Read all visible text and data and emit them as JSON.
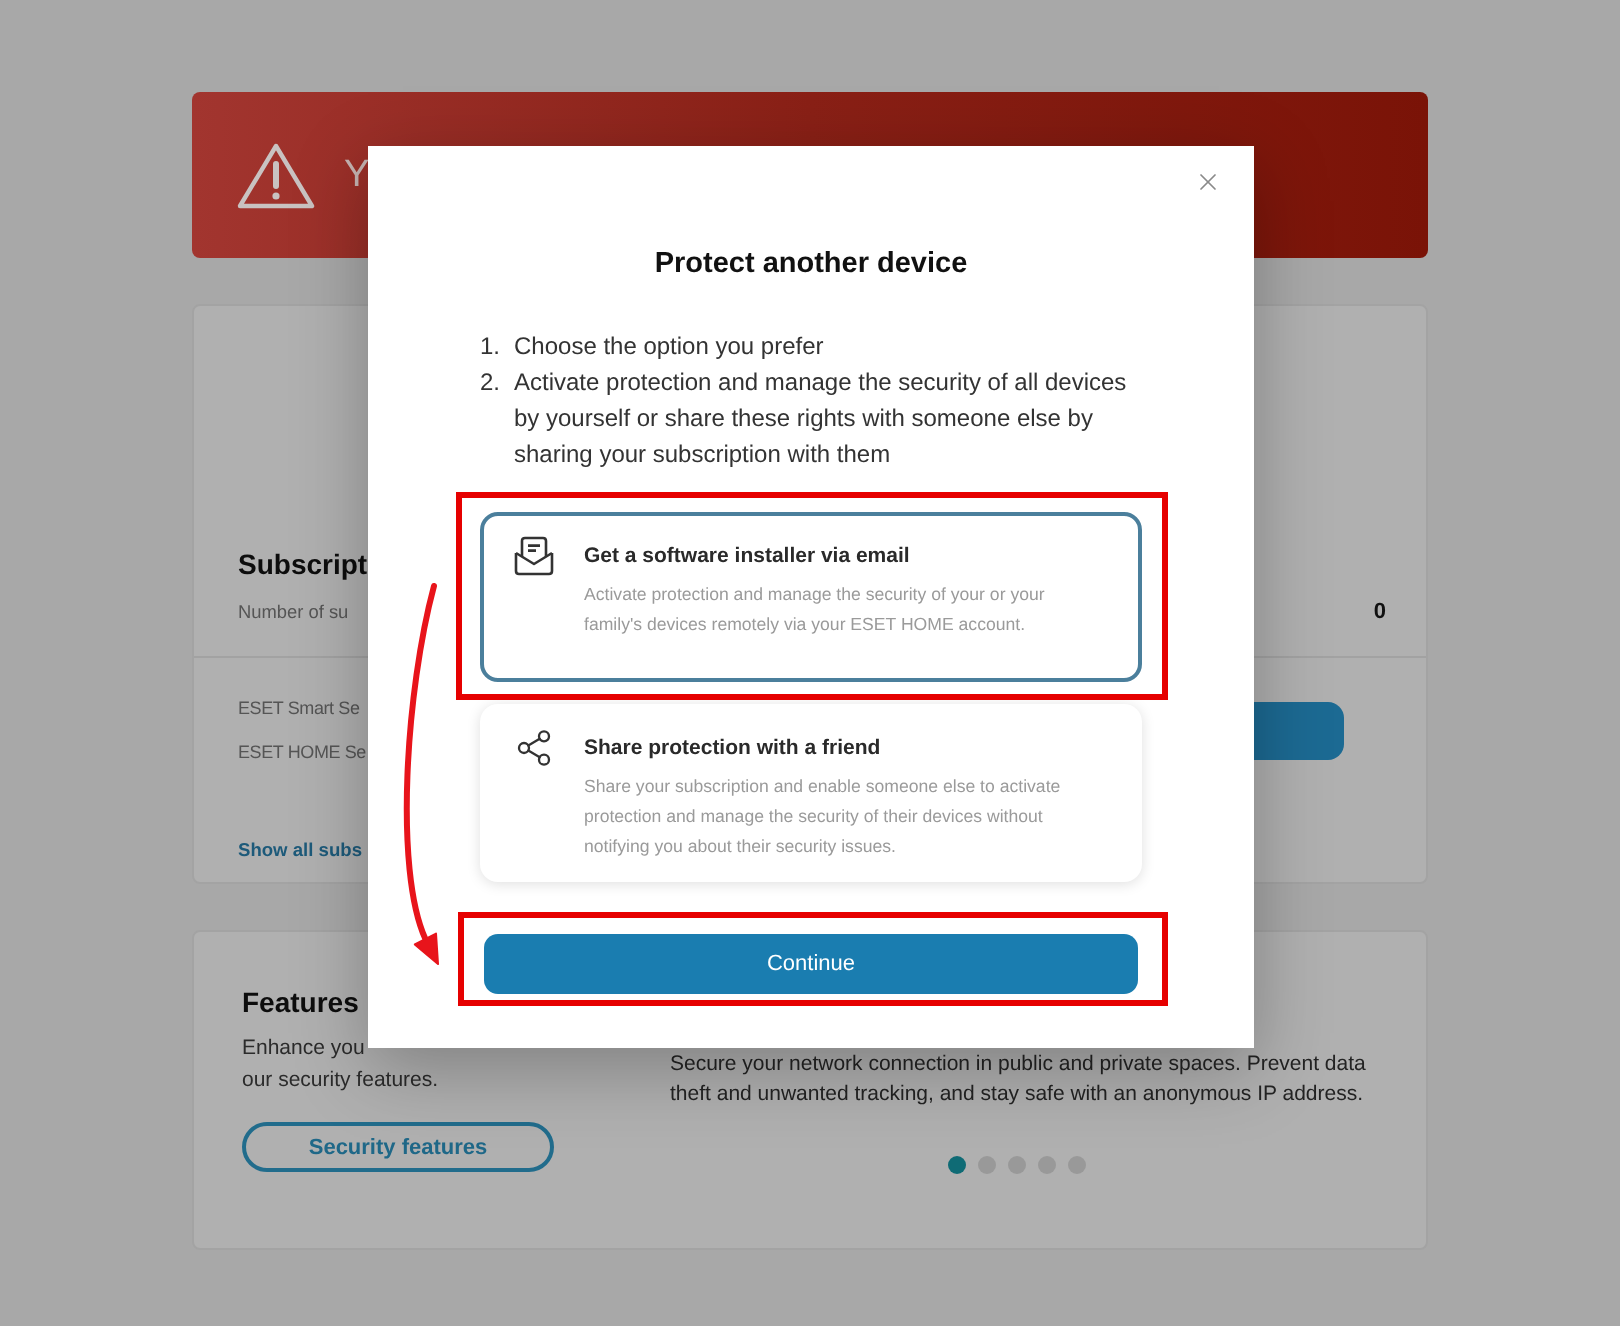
{
  "banner": {
    "text": "Y"
  },
  "subscriptions": {
    "title": "Subscript",
    "subtitle": "Number of su",
    "count": "0",
    "items": [
      "ESET Smart Se",
      "ESET HOME Se"
    ],
    "link": "Show all subs"
  },
  "features": {
    "title": "Features",
    "description_lines": [
      "Enhance you",
      "our security features."
    ],
    "button": "Security features",
    "promo_lines": [
      "Secure your network connection in public and private spaces. Prevent data",
      "theft and unwanted tracking, and stay safe with an anonymous IP address."
    ],
    "carousel_dots": [
      {
        "selected": true
      },
      {
        "selected": false
      },
      {
        "selected": false
      },
      {
        "selected": false
      },
      {
        "selected": false
      }
    ]
  },
  "dialog": {
    "title": "Protect another device",
    "steps": [
      {
        "number": "1.",
        "text": "Choose the option you prefer"
      },
      {
        "number": "2.",
        "text": "Activate protection and manage the security of all devices by yourself or share these rights with someone else by sharing your subscription with them"
      }
    ],
    "options": [
      {
        "kind": "email",
        "title": "Get a software installer via email",
        "description": "Activate protection and manage the security of your or your family's devices remotely via your ESET HOME account.",
        "selected": true
      },
      {
        "kind": "share",
        "title": "Share protection with a friend",
        "description": "Share your subscription and enable someone else to activate protection and manage the security of their devices without notifying you about their security issues.",
        "selected": false
      }
    ],
    "primary_button": "Continue"
  }
}
